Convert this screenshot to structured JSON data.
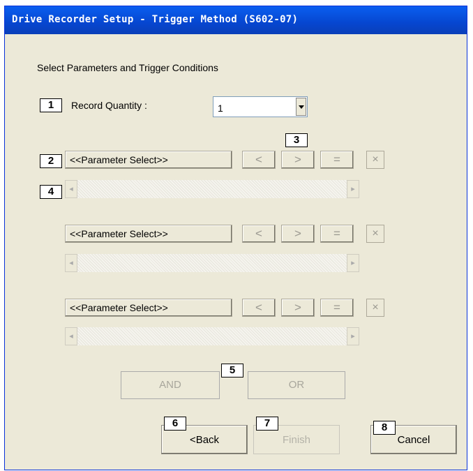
{
  "window": {
    "title": "Drive Recorder Setup - Trigger Method (S602-07)"
  },
  "instructions": "Select Parameters and Trigger Conditions",
  "callouts": [
    "1",
    "2",
    "3",
    "4",
    "5",
    "6",
    "7",
    "8"
  ],
  "record_quantity": {
    "label": "Record Quantity :",
    "value": "1"
  },
  "parameter_rows": [
    {
      "select_label": "<<Parameter Select>>",
      "less": "<",
      "greater": ">",
      "equal": "=",
      "clear": "×"
    },
    {
      "select_label": "<<Parameter Select>>",
      "less": "<",
      "greater": ">",
      "equal": "=",
      "clear": "×"
    },
    {
      "select_label": "<<Parameter Select>>",
      "less": "<",
      "greater": ">",
      "equal": "=",
      "clear": "×"
    }
  ],
  "scroll": {
    "left_arrow": "◂",
    "right_arrow": "▸"
  },
  "logic": {
    "and_label": "AND",
    "or_label": "OR"
  },
  "nav": {
    "back_label": "<Back",
    "finish_label": "Finish",
    "cancel_label": "Cancel"
  },
  "colors": {
    "title_bar": "#0646d0",
    "window_bg": "#ece9d8",
    "disabled_text": "#a8a69c"
  },
  "icons": {
    "combo_dropdown": "chevron-down-icon",
    "clear": "close-icon"
  }
}
